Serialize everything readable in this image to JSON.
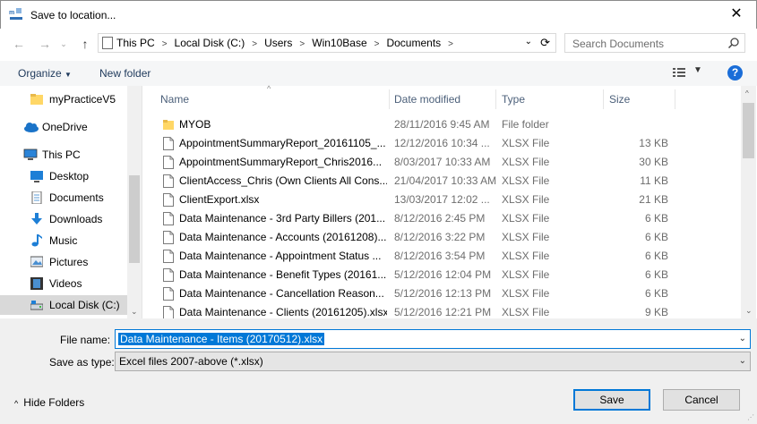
{
  "window": {
    "title": "Save to location...",
    "close_glyph": "✕"
  },
  "nav": {
    "back": "←",
    "forward": "→",
    "up": "↑"
  },
  "address": {
    "crumbs": [
      "This PC",
      "Local Disk (C:)",
      "Users",
      "Win10Base",
      "Documents"
    ],
    "dropdown": "⌄",
    "refresh": "⟳"
  },
  "search": {
    "placeholder": "Search Documents"
  },
  "toolbar": {
    "organize": "Organize",
    "organize_caret": "▼",
    "new_folder": "New folder",
    "view_caret": "▼",
    "help": "?"
  },
  "sidebar": {
    "items": [
      {
        "label": "myPracticeV5",
        "icon": "folder-icon"
      },
      {
        "label": "OneDrive",
        "icon": "cloud-icon"
      },
      {
        "label": "This PC",
        "icon": "computer-icon"
      },
      {
        "label": "Desktop",
        "icon": "desktop-icon"
      },
      {
        "label": "Documents",
        "icon": "documents-icon"
      },
      {
        "label": "Downloads",
        "icon": "downloads-icon"
      },
      {
        "label": "Music",
        "icon": "music-icon"
      },
      {
        "label": "Pictures",
        "icon": "pictures-icon"
      },
      {
        "label": "Videos",
        "icon": "videos-icon"
      },
      {
        "label": "Local Disk (C:)",
        "icon": "drive-icon",
        "selected": true
      }
    ],
    "scroll_down": "⌄"
  },
  "columns": {
    "name": "Name",
    "date": "Date modified",
    "type": "Type",
    "size": "Size",
    "sort_indicator": "^"
  },
  "files": [
    {
      "name": "MYOB",
      "date": "28/11/2016 9:45 AM",
      "type": "File folder",
      "size": "",
      "folder": true
    },
    {
      "name": "AppointmentSummaryReport_20161105_...",
      "date": "12/12/2016 10:34 ...",
      "type": "XLSX File",
      "size": "13 KB"
    },
    {
      "name": "AppointmentSummaryReport_Chris2016...",
      "date": "8/03/2017 10:33 AM",
      "type": "XLSX File",
      "size": "30 KB"
    },
    {
      "name": "ClientAccess_Chris (Own Clients All Cons...",
      "date": "21/04/2017 10:33 AM",
      "type": "XLSX File",
      "size": "11 KB"
    },
    {
      "name": "ClientExport.xlsx",
      "date": "13/03/2017 12:02 ...",
      "type": "XLSX File",
      "size": "21 KB"
    },
    {
      "name": "Data Maintenance - 3rd Party Billers (201...",
      "date": "8/12/2016 2:45 PM",
      "type": "XLSX File",
      "size": "6 KB"
    },
    {
      "name": "Data Maintenance - Accounts (20161208)...",
      "date": "8/12/2016 3:22 PM",
      "type": "XLSX File",
      "size": "6 KB"
    },
    {
      "name": "Data Maintenance - Appointment Status ...",
      "date": "8/12/2016 3:54 PM",
      "type": "XLSX File",
      "size": "6 KB"
    },
    {
      "name": "Data Maintenance - Benefit Types (20161...",
      "date": "5/12/2016 12:04 PM",
      "type": "XLSX File",
      "size": "6 KB"
    },
    {
      "name": "Data Maintenance - Cancellation Reason...",
      "date": "5/12/2016 12:13 PM",
      "type": "XLSX File",
      "size": "6 KB"
    },
    {
      "name": "Data Maintenance - Clients (20161205).xlsx",
      "date": "5/12/2016 12:21 PM",
      "type": "XLSX File",
      "size": "9 KB"
    }
  ],
  "scroll": {
    "up": "^",
    "down": "⌄"
  },
  "form": {
    "filename_label": "File name:",
    "filename_value": "Data Maintenance - Items (20170512).xlsx",
    "savetype_label": "Save as type:",
    "savetype_value": "Excel files 2007-above (*.xlsx)",
    "combo_caret": "⌄"
  },
  "footer": {
    "hide_folders": "Hide Folders",
    "hide_caret": "^",
    "save": "Save",
    "cancel": "Cancel",
    "grip": "⋰"
  },
  "colors": {
    "accent": "#0078d7",
    "folder": "#ffd766",
    "help": "#1a6dd8"
  }
}
